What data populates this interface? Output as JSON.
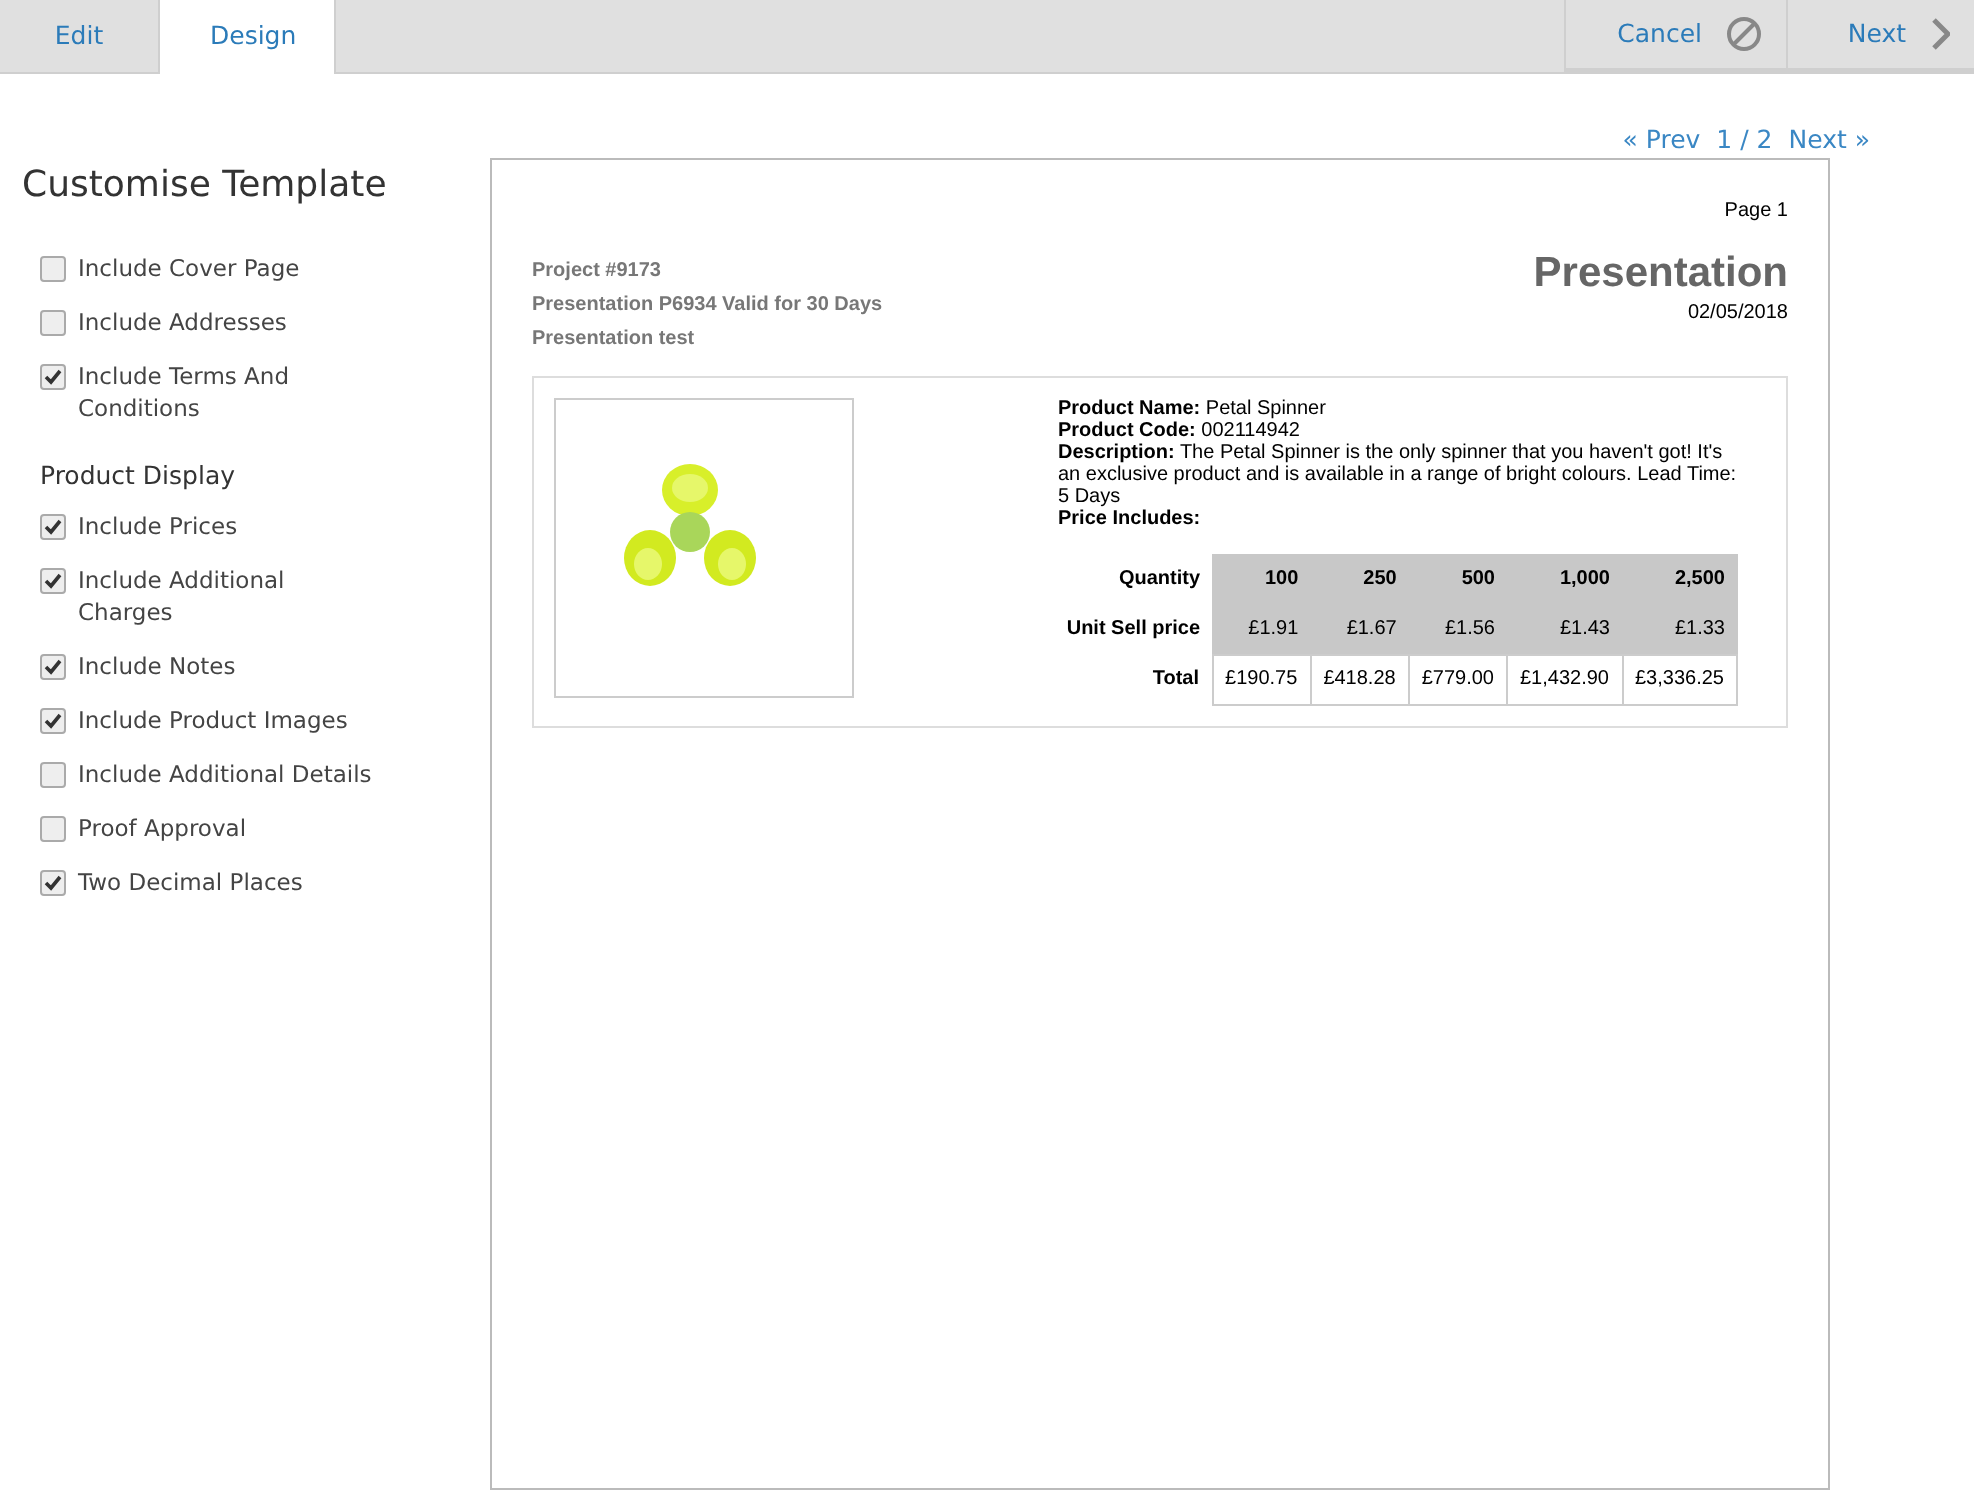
{
  "tabs": [
    {
      "label": "Edit",
      "selected": false
    },
    {
      "label": "Design",
      "selected": true
    }
  ],
  "actions": [
    {
      "kind": "cancel",
      "label": "Cancel"
    },
    {
      "kind": "next",
      "label": "Next"
    }
  ],
  "sidebar": {
    "title": "Customise Template",
    "options": [
      {
        "kind": "checkbox",
        "label": "Include Cover Page",
        "checked": false
      },
      {
        "kind": "checkbox",
        "label": "Include Addresses",
        "checked": false
      },
      {
        "kind": "checkbox",
        "label": "Include Terms And Conditions",
        "checked": true
      },
      {
        "kind": "heading",
        "label": "Product Display"
      },
      {
        "kind": "checkbox",
        "label": "Include Prices",
        "checked": true
      },
      {
        "kind": "checkbox",
        "label": "Include Additional Charges",
        "checked": true
      },
      {
        "kind": "checkbox",
        "label": "Include Notes",
        "checked": true
      },
      {
        "kind": "checkbox",
        "label": "Include Product Images",
        "checked": true
      },
      {
        "kind": "checkbox",
        "label": "Include Additional Details",
        "checked": false
      },
      {
        "kind": "checkbox",
        "label": "Proof Approval",
        "checked": false
      },
      {
        "kind": "checkbox",
        "label": "Two Decimal Places",
        "checked": true
      }
    ]
  },
  "pager": {
    "prev": "« Prev",
    "position": "1 / 2",
    "next": "Next »"
  },
  "document": {
    "page": "Page 1",
    "info": [
      "Project #9173",
      "Presentation P6934 Valid for 30 Days",
      "Presentation test"
    ],
    "title": "Presentation",
    "date": "02/05/2018",
    "product": {
      "image": {
        "kind": "picture"
      },
      "details": [
        "**Product Name:** Petal Spinner",
        "**Product Code:** 002114942",
        "**Description:** The Petal Spinner is the only spinner that you haven't got! It's an exclusive product and is available in a range of bright colours. Lead Time: 5 Days",
        "**Price Includes:**"
      ],
      "price_table": [
        {
          "header": "Quantity",
          "shaded": true,
          "cells": [
            "100",
            "250",
            "500",
            "1,000",
            "2,500"
          ]
        },
        {
          "header": "Unit Sell price",
          "shaded": true,
          "cells": [
            "£1.91",
            "£1.67",
            "£1.56",
            "£1.43",
            "£1.33"
          ]
        },
        {
          "header": "Total",
          "shaded": false,
          "cells": [
            "£190.75",
            "£418.28",
            "£779.00",
            "£1,432.90",
            "£3,336.25"
          ]
        }
      ]
    }
  }
}
